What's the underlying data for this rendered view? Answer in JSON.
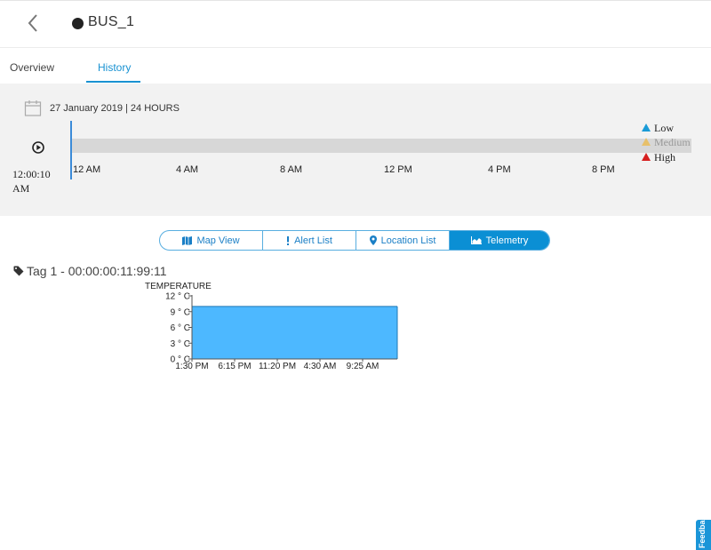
{
  "header": {
    "title": "BUS_1",
    "status_color": "#222222"
  },
  "tabs": [
    {
      "label": "Overview"
    },
    {
      "label": "History",
      "active": true
    }
  ],
  "timeline": {
    "date_label": "27 January 2019 | 24 HOURS",
    "current_time": "12:00:10 AM",
    "ticks": [
      "12 AM",
      "4 AM",
      "8 AM",
      "12 PM",
      "4 PM",
      "8 PM"
    ],
    "legend": [
      {
        "label": "Low",
        "color": "#1a9bd7"
      },
      {
        "label": "Medium",
        "color": "#e7c06a"
      },
      {
        "label": "High",
        "color": "#d61f1f"
      }
    ]
  },
  "view_buttons": [
    {
      "label": "Map View",
      "icon": "map-icon"
    },
    {
      "label": "Alert List",
      "icon": "exclamation-icon"
    },
    {
      "label": "Location List",
      "icon": "location-pin-icon"
    },
    {
      "label": "Telemetry",
      "icon": "area-chart-icon",
      "active": true
    }
  ],
  "tag": {
    "label": "Tag 1 - 00:00:00:11:99:11",
    "icon": "tag-icon"
  },
  "chart_data": {
    "type": "area",
    "title": "TEMPERATURE",
    "y_ticks": [
      "0 ° C",
      "3 ° C",
      "6 ° C",
      "9 ° C",
      "12 ° C"
    ],
    "ylim": [
      0,
      12
    ],
    "x_ticks": [
      "1:30 PM",
      "6:15 PM",
      "11:20 PM",
      "4:30 AM",
      "9:25 AM"
    ],
    "x": [
      "1:30 PM",
      "10:15 AM"
    ],
    "values": [
      10,
      10
    ],
    "fill_color": "#4db8ff",
    "line_color": "#1f77b4"
  },
  "feedback_label": "Feedback"
}
